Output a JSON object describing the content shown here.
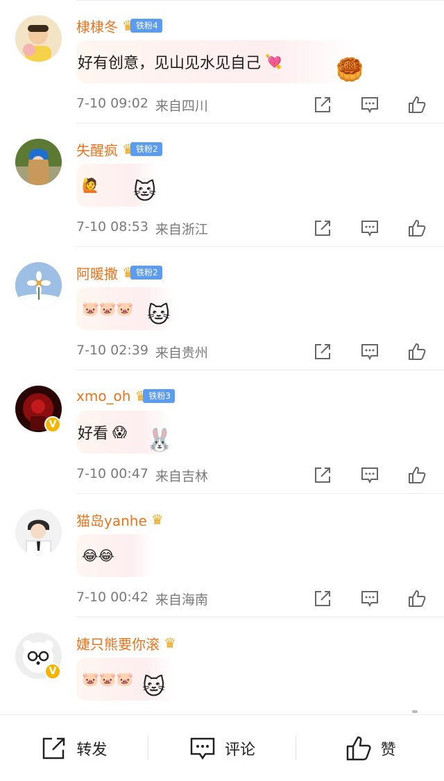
{
  "comments": [
    {
      "username": "棣棣冬",
      "fan_badge": "铁粉4",
      "text": "好有创意，见山见水见自己",
      "emoji_inline": "💘",
      "sticker": "🥮",
      "time": "7-10 09:02",
      "location": "来自四川",
      "avatar_color": "#f3d9b1",
      "verified": false
    },
    {
      "username": "失醒疯",
      "fan_badge": "铁粉2",
      "text": "",
      "emoji_inline": "🙋",
      "sticker": "🐱",
      "time": "7-10 08:53",
      "location": "来自浙江",
      "avatar_color": "#6e8a3c",
      "verified": false
    },
    {
      "username": "阿暖撒",
      "fan_badge": "铁粉2",
      "text": "",
      "emoji_inline": "🐷🐷🐷",
      "sticker": "🐱",
      "time": "7-10 02:39",
      "location": "来自贵州",
      "avatar_color": "#a9c9e8",
      "verified": false
    },
    {
      "username": "xmo_oh",
      "fan_badge": "铁粉3",
      "text": "好看",
      "emoji_inline": "😱",
      "sticker": "🐰",
      "time": "7-10 00:47",
      "location": "来自吉林",
      "avatar_color": "#3a0a0a",
      "verified": true
    },
    {
      "username": "猫岛yanhe",
      "fan_badge": "",
      "text": "",
      "emoji_inline": "😂😂",
      "sticker": "",
      "time": "7-10 00:42",
      "location": "来自海南",
      "avatar_color": "#e8e8e8",
      "verified": false
    },
    {
      "username": "婕只熊要你滚",
      "fan_badge": "",
      "text": "",
      "emoji_inline": "🐷🐷🐷",
      "sticker": "🐱",
      "time": "",
      "location": "",
      "avatar_color": "#f0f0f0",
      "verified": true
    }
  ],
  "verified_mark": "V",
  "crown_icon": "crown-icon",
  "bottom_bar": {
    "repost_label": "转发",
    "comment_label": "评论",
    "like_label": "赞"
  },
  "colors": {
    "username": "#e8741c",
    "fan_badge": "#5b9bf0",
    "meta": "#7a7a7a",
    "verified": "#f5b400"
  }
}
